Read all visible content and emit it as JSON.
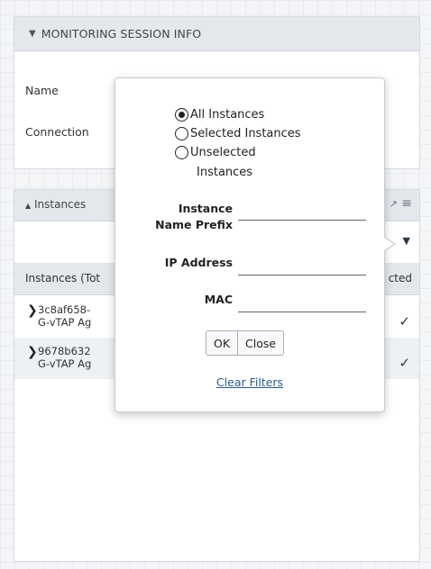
{
  "session_panel": {
    "title": "MONITORING SESSION INFO",
    "name_label": "Name",
    "connection_label": "Connection"
  },
  "instances_panel": {
    "title": "Instances",
    "column_left": "Instances (Tot",
    "column_right": "cted",
    "rows": [
      {
        "line1": "3c8af658-",
        "line2": "G-vTAP Ag"
      },
      {
        "line1": "9678b632",
        "line2": "G-vTAP Ag"
      }
    ]
  },
  "filter_popup": {
    "radio_all": "All Instances",
    "radio_selected": "Selected Instances",
    "radio_unselected_line1": "Unselected",
    "radio_unselected_line2": "Instances",
    "prefix_label_line1": "Instance",
    "prefix_label_line2": "Name Prefix",
    "ip_label": "IP Address",
    "mac_label": "MAC",
    "ok_label": "OK",
    "close_label": "Close",
    "clear_label": "Clear Filters",
    "prefix_value": "",
    "ip_value": "",
    "mac_value": ""
  },
  "icons": {
    "collapse": "chevron-down-icon",
    "expand": "chevron-right-icon",
    "filter": "filter-icon",
    "menu": "hamburger-icon",
    "maximize": "expand-icon",
    "check": "check-icon"
  }
}
